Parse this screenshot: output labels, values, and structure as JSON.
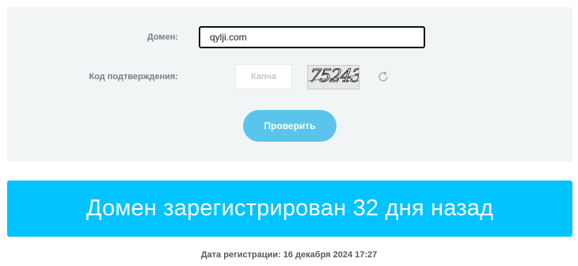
{
  "form": {
    "domain_label": "Домен:",
    "domain_value": "qylji.com",
    "code_label": "Код подтверждения:",
    "captcha_placeholder": "Капча",
    "captcha_text": "75243",
    "refresh_icon": "refresh-icon",
    "submit_label": "Проверить"
  },
  "result": {
    "headline": "Домен зарегистрирован 32 дня назад",
    "registration_date": "Дата регистрации: 16 декабря 2024 17:27"
  },
  "colors": {
    "panel_background": "#f2f5f6",
    "button": "#5bc4ec",
    "banner": "#00c3ff"
  }
}
